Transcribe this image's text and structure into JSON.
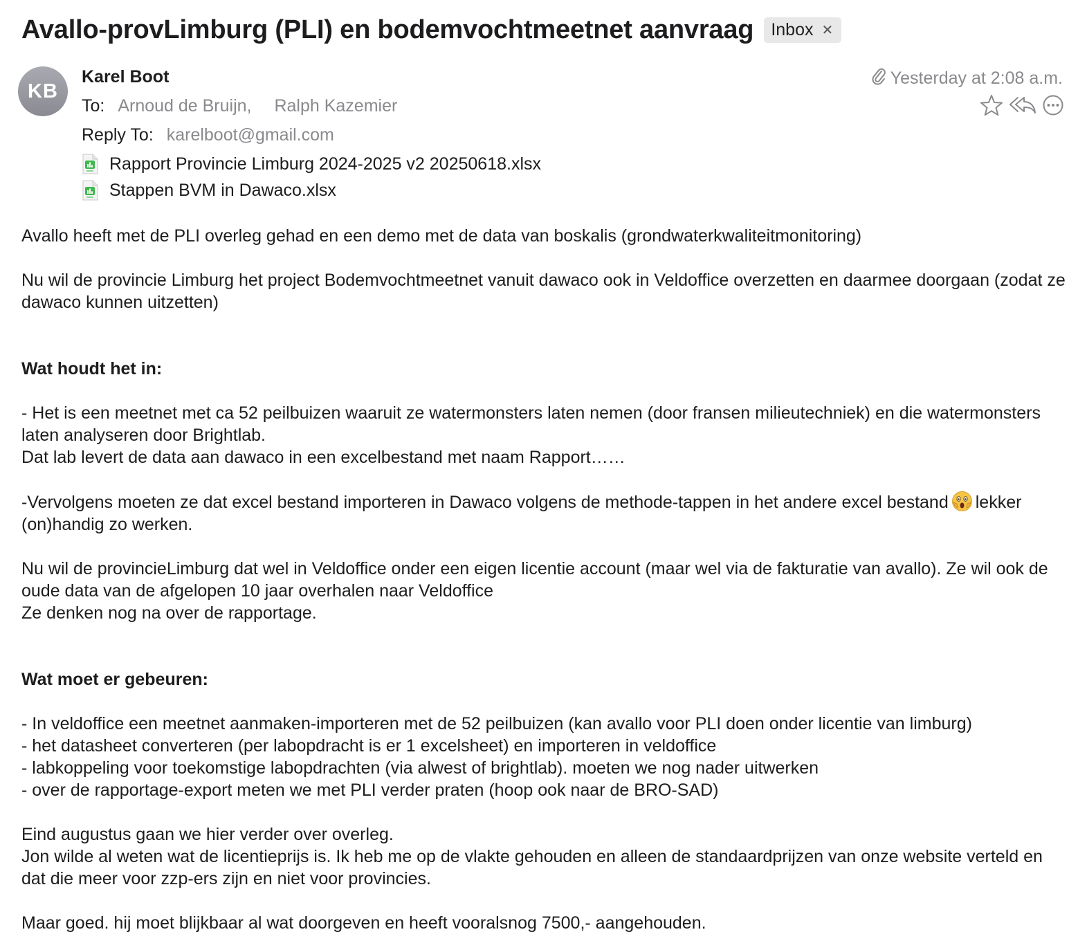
{
  "email": {
    "subject": "Avallo-provLimburg (PLI) en bodemvochtmeetnet aanvraag",
    "mailbox": "Inbox",
    "sender": {
      "initials": "KB",
      "name": "Karel Boot"
    },
    "to_label": "To:",
    "recipients": [
      "Arnoud de Bruijn,",
      "Ralph Kazemier"
    ],
    "reply_to_label": "Reply To:",
    "reply_to": "karelboot@gmail.com",
    "date": "Yesterday at 2:08 a.m.",
    "attachments": [
      {
        "name": "Rapport Provincie Limburg 2024-2025 v2 20250618.xlsx",
        "icon": "xlsx-file-icon"
      },
      {
        "name": "Stappen BVM in Dawaco.xlsx",
        "icon": "xlsx-file-icon"
      }
    ],
    "actions": [
      "star-icon",
      "reply-all-icon",
      "more-icon"
    ]
  },
  "body": {
    "p1": "Avallo heeft met de PLI overleg gehad en een demo met de data van boskalis (grondwaterkwaliteitmonitoring)",
    "p2": "Nu wil de provincie Limburg het project Bodemvochtmeetnet vanuit dawaco ook in Veldoffice overzetten en daarmee doorgaan (zodat ze dawaco kunnen uitzetten)",
    "h1": "Wat houdt het in:",
    "s1_l1": "- Het is een meetnet met ca 52 peilbuizen waaruit ze watermonsters laten nemen (door fransen milieutechniek) en die watermonsters laten analyseren door Brightlab.",
    "s1_l2": "Dat lab levert de data aan dawaco in een excelbestand met naam Rapport……",
    "s2_a": "-Vervolgens moeten ze dat excel bestand importeren in Dawaco volgens de methode-tappen in het andere excel bestand",
    "s2_b": "lekker (on)handig zo werken.",
    "s3_l1": "Nu wil de provincieLimburg dat wel in Veldoffice onder een eigen licentie account (maar wel via de fakturatie van avallo). Ze wil ook de oude data van de afgelopen 10 jaar overhalen naar Veldoffice",
    "s3_l2": "Ze denken nog na over de rapportage.",
    "h2": "Wat moet er gebeuren:",
    "todo": [
      "- In veldoffice een meetnet aanmaken-importeren met de 52 peilbuizen (kan avallo voor PLI doen onder licentie van limburg)",
      "- het datasheet converteren (per labopdracht is er 1 excelsheet) en importeren in veldoffice",
      "- labkoppeling voor toekomstige labopdrachten (via alwest of brightlab). moeten we nog nader uitwerken",
      "- over de rapportage-export meten we met PLI verder praten (hoop ook naar de BRO-SAD)"
    ],
    "s4_l1": "Eind augustus gaan we hier verder over overleg.",
    "s4_l2": "Jon wilde al weten wat de licentieprijs is. Ik heb me op de vlakte gehouden en alleen de standaardprijzen van onze website verteld en dat die meer voor zzp-ers zijn en niet voor provincies.",
    "s5": "Maar goed. hij moet blijkbaar al wat doorgeven en heeft vooralsnog 7500,- aangehouden."
  }
}
